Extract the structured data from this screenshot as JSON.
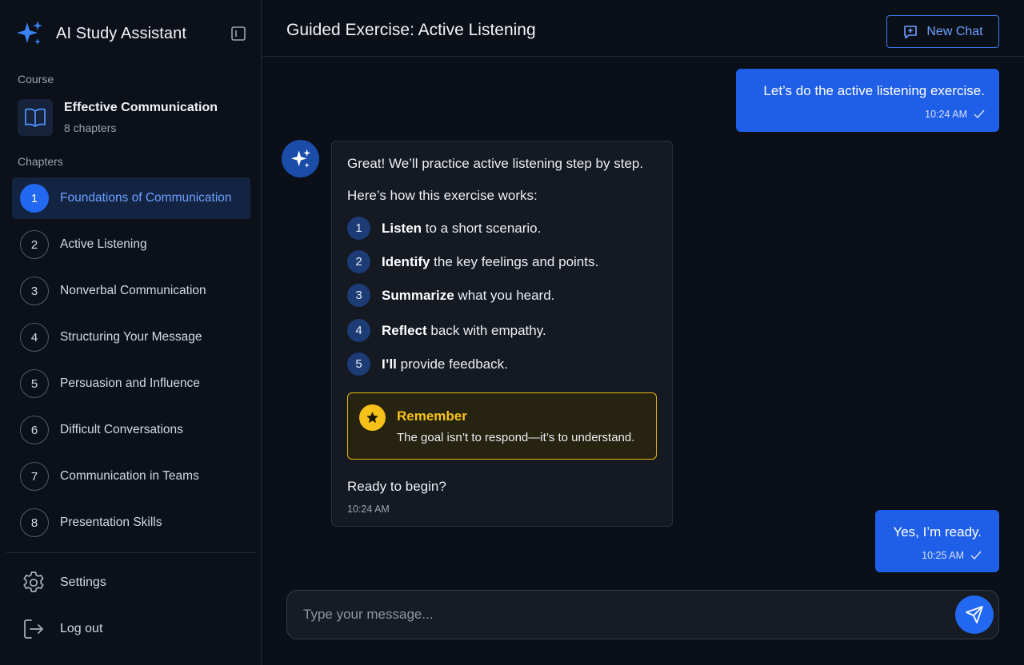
{
  "app": {
    "title": "AI Study Assistant"
  },
  "sidebar": {
    "course_label": "Course",
    "course": {
      "name": "Effective Communication",
      "sub": "8 chapters"
    },
    "chapters_label": "Chapters",
    "chapters": [
      {
        "num": "1",
        "label": "Foundations of Communication",
        "active": true
      },
      {
        "num": "2",
        "label": "Active Listening"
      },
      {
        "num": "3",
        "label": "Nonverbal Communication"
      },
      {
        "num": "4",
        "label": "Structuring Your Message"
      },
      {
        "num": "5",
        "label": "Persuasion and Influence"
      },
      {
        "num": "6",
        "label": "Difficult Conversations"
      },
      {
        "num": "7",
        "label": "Communication in Teams"
      },
      {
        "num": "8",
        "label": "Presentation Skills"
      }
    ],
    "settings_label": "Settings",
    "logout_label": "Log out"
  },
  "header": {
    "title": "Guided Exercise: Active Listening",
    "new_chat_label": "New Chat"
  },
  "messages": {
    "user1": {
      "text": "Let’s do the active listening exercise.",
      "time": "10:24 AM"
    },
    "assistant": {
      "intro": "Great! We’ll practice active listening step by step.",
      "how": "Here’s how this exercise works:",
      "steps": [
        {
          "num": "1",
          "bold": "Listen",
          "rest": " to a short scenario."
        },
        {
          "num": "2",
          "bold": "Identify",
          "rest": " the key feelings and points."
        },
        {
          "num": "3",
          "bold": "Summarize",
          "rest": " what you heard."
        },
        {
          "num": "4",
          "bold": "Reflect",
          "rest": " back with empathy."
        },
        {
          "num": "5",
          "bold": "I’ll",
          "rest": " provide feedback."
        }
      ],
      "remember_title": "Remember",
      "remember_text": "The goal isn’t to respond—it’s to understand.",
      "closing": "Ready to begin?",
      "time": "10:24 AM"
    },
    "user2": {
      "text": "Yes, I’m ready.",
      "time": "10:25 AM"
    }
  },
  "composer": {
    "placeholder": "Type your message..."
  },
  "colors": {
    "accent": "#2268f0",
    "user_bubble": "#1f5ee6",
    "remember": "#f6c21a",
    "background": "#0b0f17"
  },
  "icons": {
    "brand": "sparkle-icon",
    "collapse": "sidebar-collapse-icon",
    "course": "book-icon",
    "new_chat": "chat-plus-icon",
    "settings": "gear-icon",
    "logout": "logout-icon",
    "send": "send-icon",
    "read": "check-icon",
    "remember": "star-icon"
  }
}
